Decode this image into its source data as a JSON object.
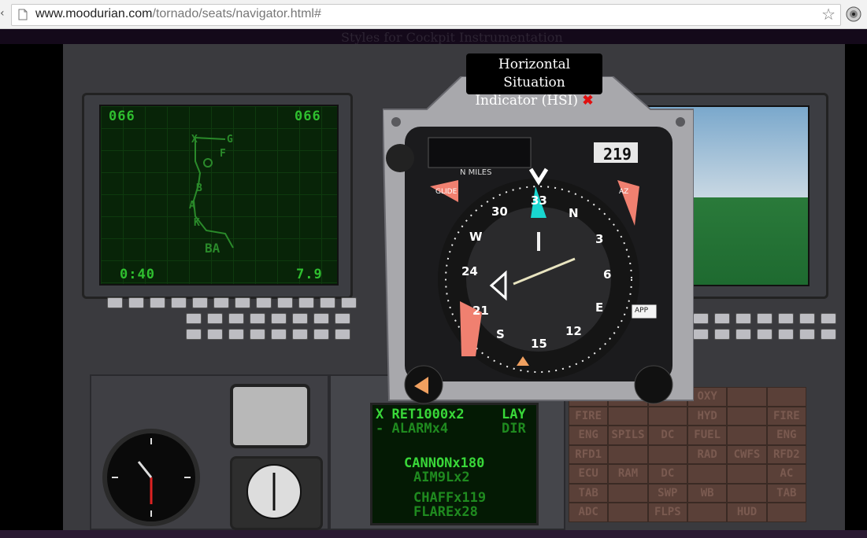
{
  "browser": {
    "url_host": "www.moodurian.com",
    "url_path": "/tornado/seats/navigator.html#",
    "bookmark_icon": "star-icon",
    "extension_icon": "extension-icon"
  },
  "page": {
    "faint_title": "Styles for Cockpit Instrumentation"
  },
  "popup": {
    "title_line1": "Horizontal Situation",
    "title_line2": "Indicator (HSI)",
    "close_label": "✖"
  },
  "hsi": {
    "miles_label": "N MILES",
    "counter": "219",
    "glide_label": "GLIDE",
    "az_label": "AZ",
    "app_label": "APP",
    "compass_labels": [
      "N",
      "3",
      "6",
      "E",
      "12",
      "15",
      "S",
      "21",
      "24",
      "W",
      "30",
      "33"
    ]
  },
  "mfd_left": {
    "top_left": "066",
    "top_right": "066",
    "bottom_left": "0:40",
    "bottom_right": "7.9",
    "waypoints": [
      "X",
      "G",
      "F",
      "B",
      "A",
      "BA",
      "K"
    ]
  },
  "stores": {
    "line1_left": "X RET1000x2",
    "line1_right": "LAY",
    "line2_left": "- ALARMx4",
    "line2_right": "DIR",
    "line3": "CANNONx180",
    "line4": "AIM9Lx2",
    "line5": "CHAFFx119",
    "line6": "FLAREx28"
  },
  "warnings": {
    "cells": [
      "",
      "",
      "",
      "OXY",
      "",
      "",
      "FIRE",
      "",
      "",
      "HYD",
      "",
      "FIRE",
      "ENG",
      "SPILS",
      "DC",
      "FUEL",
      "",
      "ENG",
      "RFD1",
      "",
      "",
      "RAD",
      "CWFS",
      "RFD2",
      "ECU",
      "RAM",
      "DC",
      "",
      "",
      "AC",
      "TAB",
      "",
      "SWP",
      "WB",
      "",
      "TAB",
      "ADC",
      "",
      "FLPS",
      "",
      "HUD",
      ""
    ]
  }
}
